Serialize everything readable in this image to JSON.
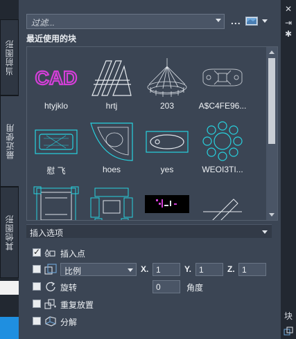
{
  "left_tabs": [
    {
      "label": "当前图形"
    },
    {
      "label": "最近使用"
    },
    {
      "label": "其他图形"
    }
  ],
  "toolbar": {
    "filter_placeholder": "过滤...",
    "more_label": "..."
  },
  "section_title": "最近使用的块",
  "blocks": [
    {
      "label": "htyjklo"
    },
    {
      "label": "hrtj"
    },
    {
      "label": "203"
    },
    {
      "label": "A$C4FE96..."
    },
    {
      "label": "慰 飞"
    },
    {
      "label": "hoes"
    },
    {
      "label": "yes"
    },
    {
      "label": "WEOI3TI..."
    },
    {
      "label": ""
    },
    {
      "label": ""
    },
    {
      "label": ""
    },
    {
      "label": ""
    }
  ],
  "insert_options": {
    "title": "插入选项",
    "insertion_point": {
      "label": "插入点",
      "checked": true
    },
    "scale": {
      "checked": false,
      "mode": "比例",
      "x_label": "X.",
      "x": "1",
      "y_label": "Y.",
      "y": "1",
      "z_label": "Z.",
      "z": "1"
    },
    "rotation": {
      "label": "旋转",
      "checked": false,
      "value": "0",
      "angle_label": "角度"
    },
    "repeat": {
      "label": "重复放置",
      "checked": false
    },
    "explode": {
      "label": "分解",
      "checked": false
    }
  },
  "right_strip": {
    "close": "✕",
    "block_label": "块"
  },
  "colors": {
    "accent_cyan": "#27d3e0",
    "cad_magenta": "#d43fd8",
    "panel_bg": "#3b4554"
  }
}
